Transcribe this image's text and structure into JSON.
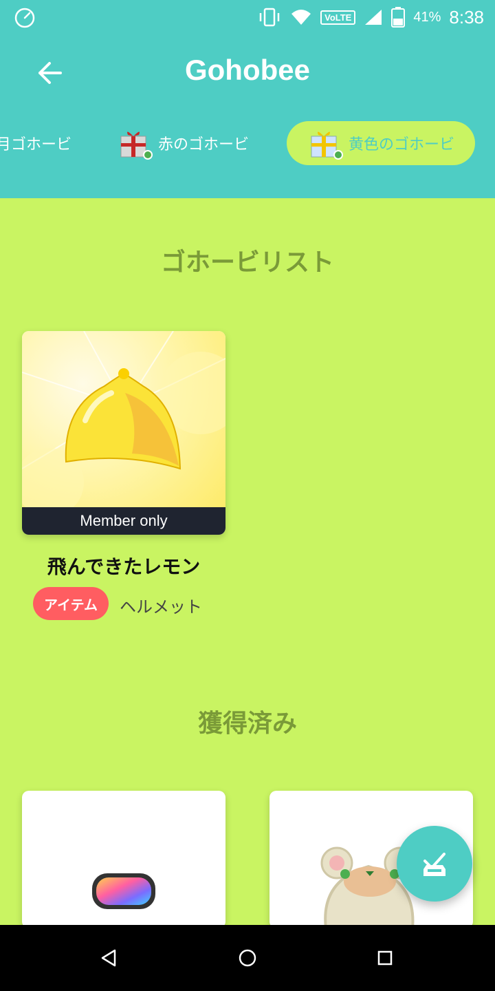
{
  "status_bar": {
    "battery_percent": "41%",
    "time": "8:38",
    "volte_label": "VoLTE",
    "icons": [
      "speedometer-icon",
      "vibrate-icon",
      "wifi-icon",
      "signal-icon",
      "battery-icon"
    ]
  },
  "app_bar": {
    "title": "Gohobee",
    "back_icon": "arrow-left-icon"
  },
  "tabs": [
    {
      "label": "青のゴホービ",
      "partial_visible": "月ゴホービ",
      "selected": false
    },
    {
      "label": "赤のゴホービ",
      "selected": false
    },
    {
      "label": "黄色のゴホービ",
      "selected": true
    }
  ],
  "sections": {
    "list_title": "ゴホービリスト",
    "acquired_title": "獲得済み"
  },
  "list_items": [
    {
      "band": "Member only",
      "name": "飛んできたレモン",
      "badge": "アイテム",
      "category": "ヘルメット"
    }
  ],
  "acquired_items": [
    {
      "icon": "goggles-icon"
    },
    {
      "icon": "bear-hat-icon"
    }
  ],
  "colors": {
    "accent": "#4ecdc4",
    "background": "#c9f462",
    "badge": "#ff5d61",
    "section_title": "#7a9a38"
  },
  "fab": {
    "icon": "check-tray-icon"
  },
  "nav_bar": {
    "icons": [
      "back-triangle-icon",
      "home-circle-icon",
      "recents-square-icon"
    ]
  }
}
